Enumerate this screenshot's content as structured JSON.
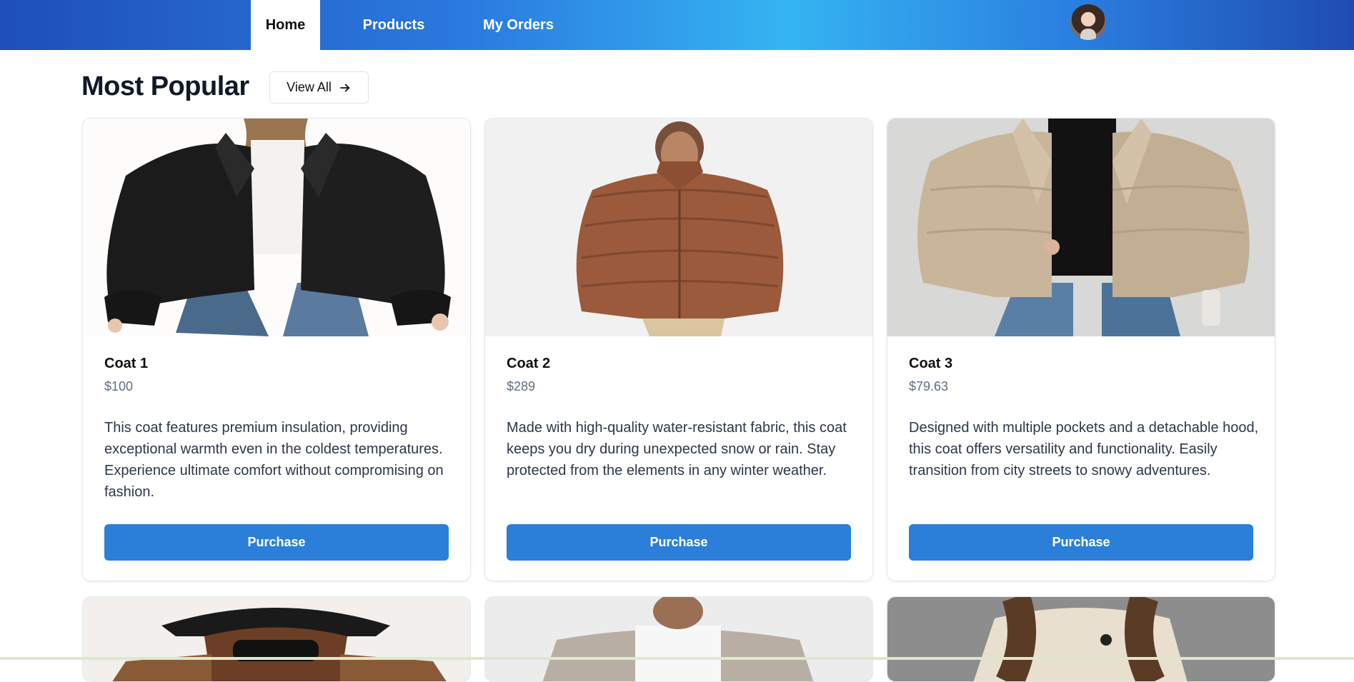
{
  "nav": {
    "tabs": [
      {
        "label": "Home",
        "active": true
      },
      {
        "label": "Products",
        "active": false
      },
      {
        "label": "My Orders",
        "active": false
      }
    ],
    "avatar_icon": "user-avatar"
  },
  "section": {
    "title": "Most Popular",
    "view_all_label": "View All",
    "view_all_icon": "arrow-right-icon"
  },
  "products": [
    {
      "name": "Coat 1",
      "price": "$100",
      "description": "This coat features premium insulation, providing exceptional warmth even in the coldest temperatures. Experience ultimate comfort without compromising on fashion.",
      "button": "Purchase",
      "image_color": "#1c1c1c"
    },
    {
      "name": "Coat 2",
      "price": "$289",
      "description": "Made with high-quality water-resistant fabric, this coat keeps you dry during unexpected snow or rain. Stay protected from the elements in any winter weather.",
      "button": "Purchase",
      "image_color": "#9a5a3b"
    },
    {
      "name": "Coat 3",
      "price": "$79.63",
      "description": "Designed with multiple pockets and a detachable hood, this coat offers versatility and functionality. Easily transition from city streets to snowy adventures.",
      "button": "Purchase",
      "image_color": "#c8b59a"
    }
  ],
  "colors": {
    "accent": "#2b7fd8",
    "nav_gradient_mid": "#35b4f2",
    "nav_gradient_edge": "#1e4fb8"
  }
}
